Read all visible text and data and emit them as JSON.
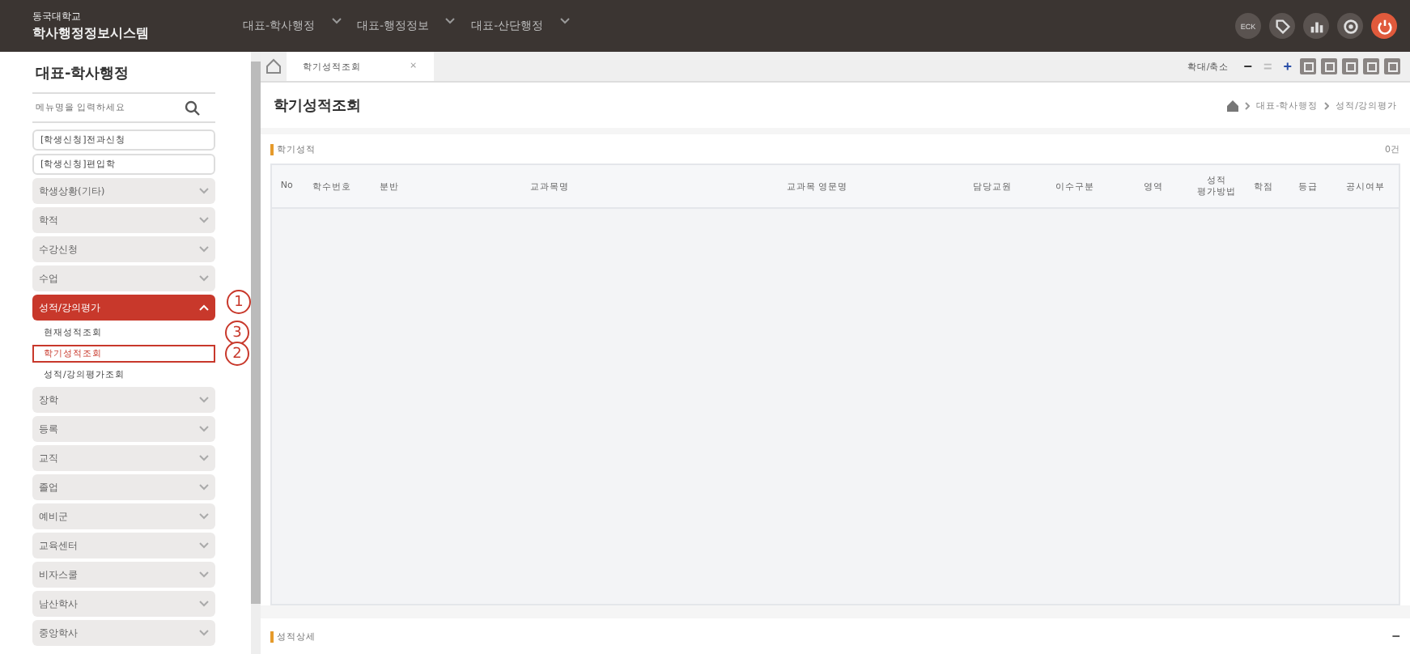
{
  "header": {
    "school": "동국대학교",
    "system": "학사행정정보시스템",
    "nav": [
      "대표-학사행정",
      "대표-행정정보",
      "대표-산단행정"
    ],
    "user_badge": "ECK"
  },
  "sidebar": {
    "title": "대표-학사행정",
    "search": {
      "placeholder": "메뉴명을 입력하세요"
    },
    "quick": [
      "[학생신청]전과신청",
      "[학생신청]편입학"
    ],
    "groups": [
      {
        "label": "학생상황(기타)",
        "expanded": false
      },
      {
        "label": "학적",
        "expanded": false
      },
      {
        "label": "수강신청",
        "expanded": false
      },
      {
        "label": "수업",
        "expanded": false
      },
      {
        "label": "성적/강의평가",
        "expanded": true,
        "children": [
          {
            "label": "현재성적조회",
            "selected": false
          },
          {
            "label": "학기성적조회",
            "selected": true
          },
          {
            "label": "성적/강의평가조회",
            "selected": false
          }
        ]
      },
      {
        "label": "장학",
        "expanded": false
      },
      {
        "label": "등록",
        "expanded": false
      },
      {
        "label": "교직",
        "expanded": false
      },
      {
        "label": "졸업",
        "expanded": false
      },
      {
        "label": "예비군",
        "expanded": false
      },
      {
        "label": "교육센터",
        "expanded": false
      },
      {
        "label": "비자스쿨",
        "expanded": false
      },
      {
        "label": "남산학사",
        "expanded": false
      },
      {
        "label": "중앙학사",
        "expanded": false
      }
    ]
  },
  "annotations": [
    "1",
    "3",
    "2"
  ],
  "tabs": [
    {
      "label": "학기성적조회",
      "selected": true,
      "close": "×"
    }
  ],
  "zoom": {
    "label": "확대/축소",
    "minus": "−",
    "reset": "=",
    "plus": "+"
  },
  "page": {
    "title": "학기성적조회",
    "breadcrumb": [
      "대표-학사행정",
      "성적/강의평가"
    ]
  },
  "grades": {
    "title": "학기성적",
    "count": "0건",
    "columns": [
      "No",
      "학수번호",
      "분반",
      "교과목명",
      "교과목 영문명",
      "담당교원",
      "이수구분",
      "영역",
      "성적\n평가방법",
      "학점",
      "등급",
      "공시여부"
    ]
  },
  "detail": {
    "title": "성적상세",
    "collapse": "−"
  }
}
